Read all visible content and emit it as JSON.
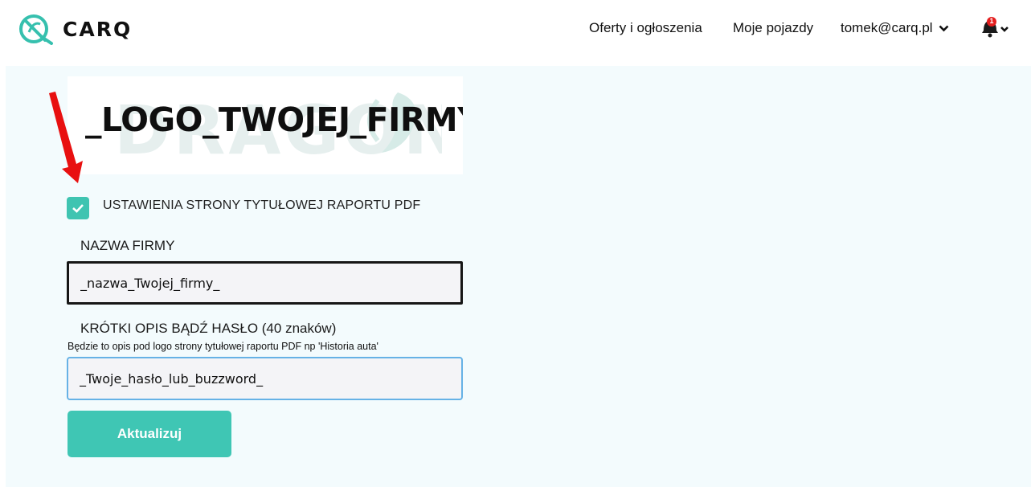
{
  "header": {
    "brand": "CARQ",
    "nav": {
      "offers": "Oferty i ogłoszenia",
      "vehicles": "Moje pojazdy",
      "user": "tomek@carq.pl"
    },
    "notification_count": "1"
  },
  "logo": {
    "text": "_LOGO_TWOJEJ_FIRMY_",
    "watermark": "DRAGON"
  },
  "form": {
    "checkbox_label": "USTAWIENIA STRONY TYTUŁOWEJ RAPORTU PDF",
    "checkbox_checked": true,
    "company_label": "NAZWA FIRMY",
    "company_value": "_nazwa_Twojej_firmy_",
    "desc_label": "KRÓTKI OPIS BĄDŹ HASŁO (40 znaków)",
    "desc_hint": "Będzie to opis pod logo strony tytułowej raportu PDF np 'Historia auta'",
    "desc_value": "_Twoje_hasło_lub_buzzword_",
    "submit_label": "Aktualizuj"
  },
  "colors": {
    "accent": "#3fc6b4",
    "panel_bg": "#f3fbfd",
    "arrow": "#e81010",
    "badge": "#e41e1e"
  },
  "icons": [
    "carq-logo-icon",
    "chevron-down-icon",
    "bell-icon",
    "check-icon",
    "red-arrow"
  ]
}
